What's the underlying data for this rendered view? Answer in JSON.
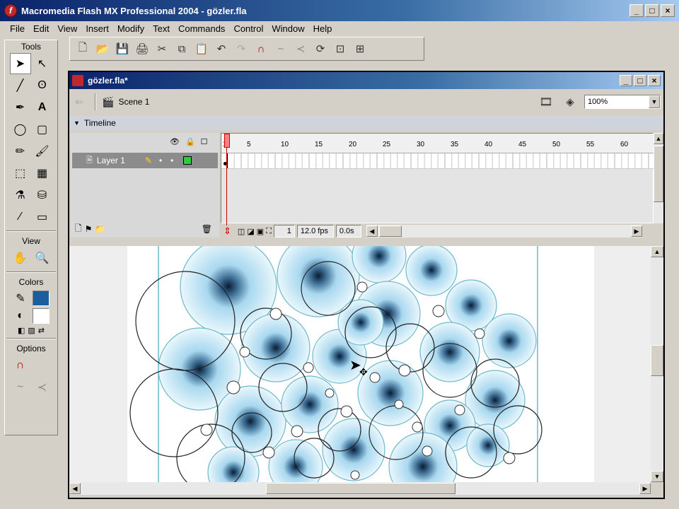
{
  "app": {
    "title": "Macromedia Flash MX Professional 2004 - gözler.fla",
    "window_buttons": [
      "_",
      "□",
      "×"
    ]
  },
  "menu": [
    "File",
    "Edit",
    "View",
    "Insert",
    "Modify",
    "Text",
    "Commands",
    "Control",
    "Window",
    "Help"
  ],
  "tools": {
    "header": "Tools",
    "view_header": "View",
    "colors_header": "Colors",
    "options_header": "Options"
  },
  "document": {
    "title": "gözler.fla*",
    "scene_label": "Scene 1",
    "zoom": "100%"
  },
  "timeline": {
    "header": "Timeline",
    "ruler_numbers": [
      "1",
      "5",
      "10",
      "15",
      "20",
      "25",
      "30",
      "35",
      "40",
      "45",
      "50",
      "55",
      "60"
    ],
    "layer_name": "Layer 1",
    "current_frame": "1",
    "frame_rate": "12.0 fps",
    "elapsed": "0.0s"
  }
}
